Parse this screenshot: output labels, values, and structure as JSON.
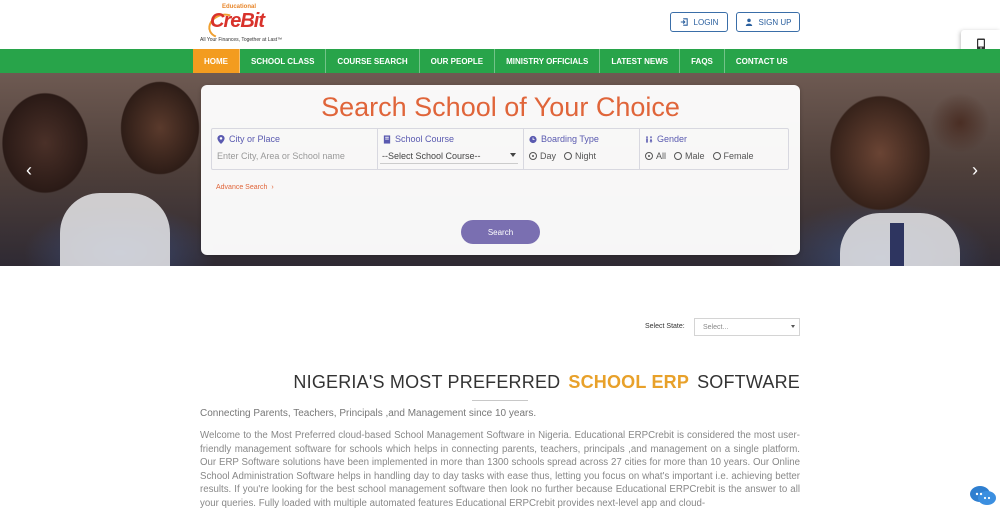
{
  "header": {
    "logo": {
      "top_text": "Educational",
      "brand": "CreBit",
      "tagline": "All Your Finances, Together at Last™"
    },
    "login_label": "LOGIN",
    "signup_label": "SIGN UP"
  },
  "nav": {
    "items": [
      "HOME",
      "SCHOOL CLASS",
      "COURSE SEARCH",
      "OUR PEOPLE",
      "MINISTRY OFFICIALS",
      "LATEST NEWS",
      "FAQS",
      "CONTACT US"
    ],
    "active": "HOME"
  },
  "search": {
    "title": "Search School of Your Choice",
    "city": {
      "label": "City or Place",
      "placeholder": "Enter City, Area or School name"
    },
    "course": {
      "label": "School Course",
      "selected": "--Select School Course--"
    },
    "boarding": {
      "label": "Boarding Type",
      "options": [
        "Day",
        "Night"
      ],
      "selected": "Day"
    },
    "gender": {
      "label": "Gender",
      "options": [
        "All",
        "Male",
        "Female"
      ],
      "selected": "All"
    },
    "advanced_label": "Advance Search",
    "button_label": "Search"
  },
  "state": {
    "label": "Select State:",
    "selected": "Select..."
  },
  "content": {
    "headline_pre": "NIGERIA'S MOST PREFERRED",
    "headline_highlight": "SCHOOL ERP",
    "headline_post": "SOFTWARE",
    "tagline": "Connecting Parents, Teachers, Principals ,and Management since 10 years.",
    "paragraph": "Welcome to the Most Preferred cloud-based School Management Software in Nigeria. Educational ERPCrebit is considered the most user-friendly management software for schools which helps in connecting parents, teachers, principals ,and management on a single platform. Our ERP Software solutions have been implemented in more than 1300 schools spread across 27 cities for more than 10 years. Our Online School Administration Software helps in handling day to day tasks with ease thus, letting you focus on what's important i.e. achieving better results. If you're looking for the best school management software then look no further because Educational ERPCrebit is the answer to all your queries. Fully loaded with multiple automated features Educational ERPCrebit provides next-level app and cloud-"
  },
  "colors": {
    "nav_green": "#28a44a",
    "active_orange": "#f39c1f",
    "title_orange": "#e0653a",
    "button_purple": "#7a6fb1",
    "highlight": "#e8a12a",
    "login_blue": "#2a5f9e"
  },
  "icons": [
    "user-icon",
    "map-pin-icon",
    "book-icon",
    "clock-icon",
    "gender-icon",
    "chevron-right-icon",
    "chat-icon",
    "tablet-icon"
  ]
}
